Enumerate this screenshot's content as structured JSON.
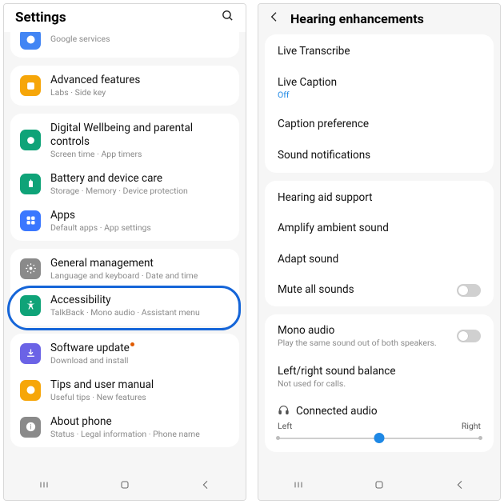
{
  "left": {
    "header": {
      "title": "Settings"
    },
    "items": [
      {
        "title": "",
        "sub": "Google services",
        "color": "#4285f4",
        "icon": "google"
      },
      {
        "title": "Advanced features",
        "sub": "Labs  ·  Side key",
        "color": "#f6a609",
        "icon": "adv"
      },
      {
        "title": "Digital Wellbeing and parental controls",
        "sub": "Screen time  ·  App timers",
        "color": "#0fa378",
        "icon": "wellbeing"
      },
      {
        "title": "Battery and device care",
        "sub": "Storage  ·  Memory  ·  Device protection",
        "color": "#0fa378",
        "icon": "care"
      },
      {
        "title": "Apps",
        "sub": "Default apps  ·  App settings",
        "color": "#3a77ff",
        "icon": "apps"
      },
      {
        "title": "General management",
        "sub": "Language and keyboard  ·  Date and time",
        "color": "#8a8a8a",
        "icon": "gear"
      },
      {
        "title": "Accessibility",
        "sub": "TalkBack  ·  Mono audio  ·  Assistant menu",
        "color": "#0fa378",
        "icon": "accessibility"
      },
      {
        "title": "Software update",
        "sub": "Download and install",
        "color": "#6b63e6",
        "icon": "update",
        "badge": true
      },
      {
        "title": "Tips and user manual",
        "sub": "Useful tips  ·  New features",
        "color": "#f6a609",
        "icon": "tips"
      },
      {
        "title": "About phone",
        "sub": "Status  ·  Legal information  ·  Phone name",
        "color": "#8a8a8a",
        "icon": "info"
      }
    ]
  },
  "right": {
    "header": {
      "title": "Hearing enhancements"
    },
    "g1": [
      {
        "title": "Live Transcribe"
      },
      {
        "title": "Live Caption",
        "status": "Off"
      },
      {
        "title": "Caption preference"
      },
      {
        "title": "Sound notifications"
      }
    ],
    "g2": [
      {
        "title": "Hearing aid support"
      },
      {
        "title": "Amplify ambient sound"
      },
      {
        "title": "Adapt sound"
      },
      {
        "title": "Mute all sounds",
        "toggle": true
      }
    ],
    "g3": {
      "mono": {
        "title": "Mono audio",
        "sub": "Play the same sound out of both speakers."
      },
      "balance": {
        "title": "Left/right sound balance",
        "sub": "Not used for calls."
      },
      "connected": "Connected audio",
      "left": "Left",
      "right": "Right"
    }
  }
}
